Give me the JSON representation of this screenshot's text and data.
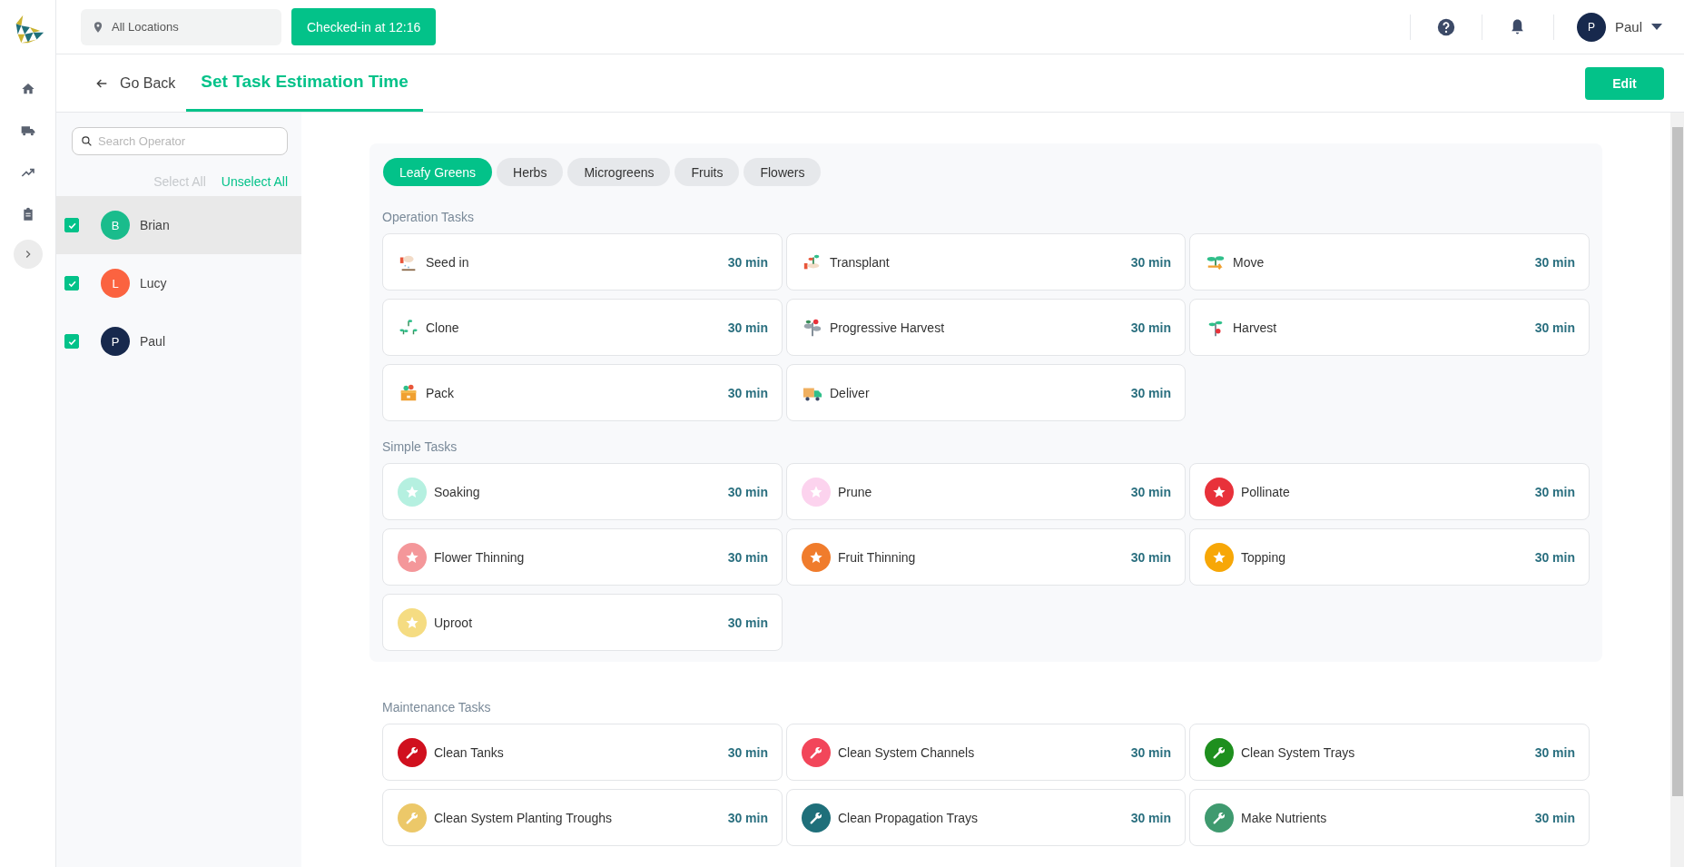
{
  "top_bar": {
    "location_filter": "All Locations",
    "check_in_button": "Checked-in at 12:16",
    "user": {
      "initial": "P",
      "name": "Paul"
    }
  },
  "page_header": {
    "back_link": "Go Back",
    "tabs": [
      {
        "label": "Set Task Estimation Time",
        "selected": true
      }
    ],
    "edit_button": "Edit"
  },
  "operators": {
    "search": {
      "placeholder": "Search Operator"
    },
    "select_all": {
      "label": "Select All",
      "disabled": true
    },
    "unselect_all": {
      "label": "Unselect All",
      "disabled": false
    },
    "items": [
      {
        "initial": "B",
        "name": "Brian",
        "color": "#1abc8c",
        "checked": true,
        "selected": true
      },
      {
        "initial": "L",
        "name": "Lucy",
        "color": "#fb6340",
        "checked": true,
        "selected": false
      },
      {
        "initial": "P",
        "name": "Paul",
        "color": "#17294d",
        "checked": true,
        "selected": false
      }
    ]
  },
  "crop_panel": {
    "tabs": [
      {
        "label": "Leafy Greens",
        "selected": true
      },
      {
        "label": "Herbs",
        "selected": false
      },
      {
        "label": "Microgreens",
        "selected": false
      },
      {
        "label": "Fruits",
        "selected": false
      },
      {
        "label": "Flowers",
        "selected": false
      }
    ],
    "sections": [
      {
        "title": "Operation Tasks",
        "kind": "illustrated",
        "tasks": [
          {
            "name": "Seed in",
            "duration": "30 min"
          },
          {
            "name": "Transplant",
            "duration": "30 min"
          },
          {
            "name": "Move",
            "duration": "30 min"
          },
          {
            "name": "Clone",
            "duration": "30 min"
          },
          {
            "name": "Progressive Harvest",
            "duration": "30 min"
          },
          {
            "name": "Harvest",
            "duration": "30 min"
          },
          {
            "name": "Pack",
            "duration": "30 min"
          },
          {
            "name": "Deliver",
            "duration": "30 min"
          }
        ]
      },
      {
        "title": "Simple Tasks",
        "kind": "star",
        "tasks": [
          {
            "name": "Soaking",
            "duration": "30 min",
            "color": "#b5f0e0"
          },
          {
            "name": "Prune",
            "duration": "30 min",
            "color": "#fcd3ee"
          },
          {
            "name": "Pollinate",
            "duration": "30 min",
            "color": "#e8313a"
          },
          {
            "name": "Flower Thinning",
            "duration": "30 min",
            "color": "#f4979a"
          },
          {
            "name": "Fruit Thinning",
            "duration": "30 min",
            "color": "#f07c2c"
          },
          {
            "name": "Topping",
            "duration": "30 min",
            "color": "#f7a707"
          },
          {
            "name": "Uproot",
            "duration": "30 min",
            "color": "#f5dc82"
          }
        ]
      }
    ]
  },
  "maintenance": {
    "title": "Maintenance Tasks",
    "kind": "wrench",
    "tasks": [
      {
        "name": "Clean Tanks",
        "duration": "30 min",
        "color": "#d0101e"
      },
      {
        "name": "Clean System Channels",
        "duration": "30 min",
        "color": "#f2465a"
      },
      {
        "name": "Clean System Trays",
        "duration": "30 min",
        "color": "#1e8f1e"
      },
      {
        "name": "Clean System Planting Troughs",
        "duration": "30 min",
        "color": "#ecc869"
      },
      {
        "name": "Clean Propagation Trays",
        "duration": "30 min",
        "color": "#1f6f7a"
      },
      {
        "name": "Make Nutrients",
        "duration": "30 min",
        "color": "#3f9a6f"
      }
    ]
  }
}
